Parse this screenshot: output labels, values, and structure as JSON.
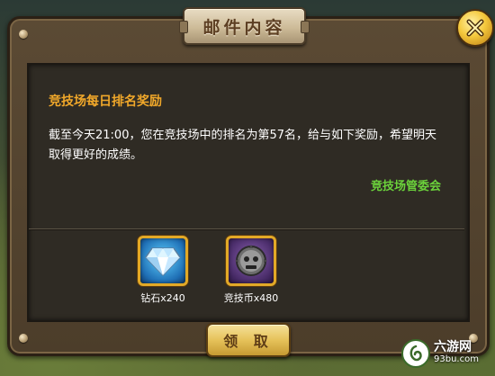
{
  "dialog": {
    "title": "邮件内容"
  },
  "mail": {
    "title": "竞技场每日排名奖励",
    "body": "截至今天21:00，您在竞技场中的排名为第57名，给与如下奖励，希望明天取得更好的成绩。",
    "sender": "竞技场管委会"
  },
  "rewards": [
    {
      "icon": "diamond-icon",
      "label": "钻石x240"
    },
    {
      "icon": "arena-coin-icon",
      "label": "竞技币x480"
    }
  ],
  "actions": {
    "claim_label": "领 取"
  },
  "watermark": {
    "name": "六游网",
    "url": "93bu.com"
  },
  "colors": {
    "mail_title": "#f1a82a",
    "sender": "#6bd23b",
    "button_gold": "#e6c25a"
  }
}
